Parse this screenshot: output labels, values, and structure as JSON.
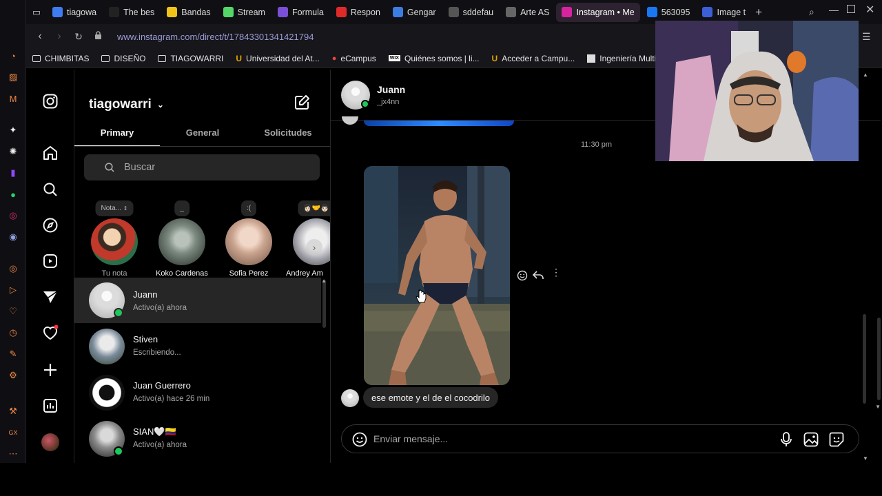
{
  "tabs": [
    {
      "label": "tiagowa",
      "color": "#3f7cf0"
    },
    {
      "label": "The bes",
      "color": "#222"
    },
    {
      "label": "Bandas",
      "color": "#f0c419"
    },
    {
      "label": "Stream",
      "color": "#53d769"
    },
    {
      "label": "Formula",
      "color": "#7b4fd6"
    },
    {
      "label": "Respon",
      "color": "#e02a2a"
    },
    {
      "label": "Gengar",
      "color": "#3b7de0"
    },
    {
      "label": "sddefau",
      "color": "#555"
    },
    {
      "label": "Arte AS",
      "color": "#666"
    },
    {
      "label": "Instagram • Me",
      "color": "#d6249f",
      "active": true
    },
    {
      "label": "563095",
      "color": "#1877f2"
    },
    {
      "label": "Image t",
      "color": "#3c5fd8"
    }
  ],
  "address": {
    "url": "www.instagram.com/direct/t/17843301341421794"
  },
  "bookmarks": [
    "CHIMBITAS",
    "DISEÑO",
    "TIAGOWARRI",
    "Universidad del At...",
    "eCampus",
    "Quiénes somos | li...",
    "Acceder a Campu...",
    "Ingeniería Multi"
  ],
  "inbox": {
    "username": "tiagowarri",
    "tabs": [
      "Primary",
      "General",
      "Solicitudes"
    ],
    "search_placeholder": "Buscar",
    "notes": [
      {
        "bubble": "Nota...",
        "name": "Tu nota",
        "color": "#c0392b"
      },
      {
        "bubble": "_",
        "name": "Koko Cardenas",
        "color": "#7c8a80"
      },
      {
        "bubble": ":(",
        "name": "Sofia Perez",
        "color": "#c9a38e"
      },
      {
        "bubble": "👩🏻‍🤝‍👨🏻",
        "name": "Andrey Am",
        "color": "#9a9aa3"
      }
    ],
    "threads": [
      {
        "name": "Juann",
        "status": "Activo(a) ahora",
        "online": true,
        "selected": true,
        "color": "#d8d8d8"
      },
      {
        "name": "Stiven",
        "status": "Escribiendo...",
        "online": false,
        "color": "#7a8a9a"
      },
      {
        "name": "Juan Guerrero",
        "status": "Activo(a) hace 26 min",
        "online": false,
        "color": "#e8e8e8"
      },
      {
        "name": "SIAN🤍🇨🇴",
        "status": "Activo(a) ahora",
        "online": true,
        "color": "#8a8a8a"
      }
    ]
  },
  "chat": {
    "name": "Juann",
    "handle": "_jx4nn",
    "time": "11:30 pm",
    "message": "ese emote y el de el cocodrilo",
    "composer_placeholder": "Enviar mensaje..."
  }
}
